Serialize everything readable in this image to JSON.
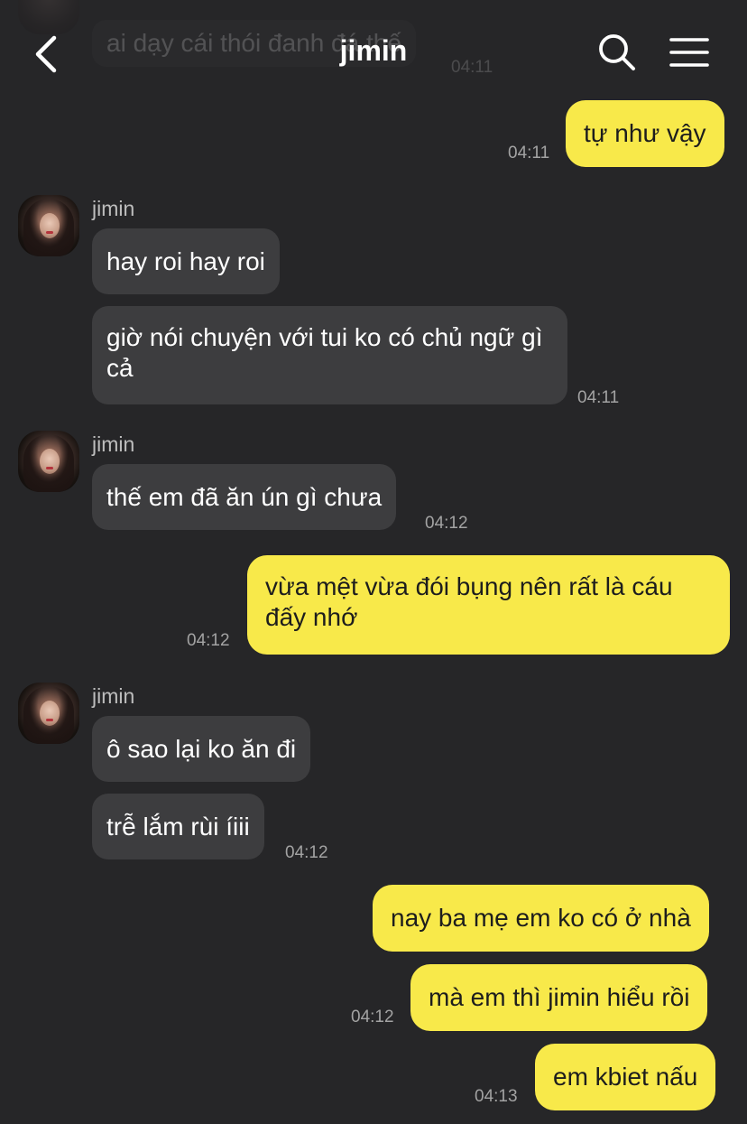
{
  "header": {
    "title": "jimin"
  },
  "ghost": {
    "text": "ai dạy cái thói đanh đá thế",
    "time": "04:11"
  },
  "messages": [
    {
      "text": "tự như vậy",
      "time": "04:11"
    },
    {
      "sender": "jimin",
      "text": "hay roi hay roi"
    },
    {
      "text": "giờ nói chuyện với tui ko có chủ ngữ gì cả",
      "time": "04:11"
    },
    {
      "sender": "jimin",
      "text": "thế em đã ăn ún gì chưa",
      "time": "04:12"
    },
    {
      "text": "vừa mệt vừa đói bụng nên rất là cáu đấy nhớ",
      "time": "04:12"
    },
    {
      "sender": "jimin",
      "text": "ô sao lại ko ăn đi"
    },
    {
      "text": "trễ lắm rùi íiii",
      "time": "04:12"
    },
    {
      "text": "nay ba mẹ em ko có ở nhà"
    },
    {
      "text": "mà em thì jimin hiểu rồi",
      "time": "04:12"
    },
    {
      "text": "em kbiet nấu",
      "time": "04:13"
    }
  ],
  "colors": {
    "background": "#262628",
    "incoming_bubble": "#3d3d3f",
    "outgoing_bubble": "#f8e94a",
    "timestamp": "#a3a3a3"
  },
  "icons": [
    "back-chevron-icon",
    "search-icon",
    "menu-icon"
  ]
}
